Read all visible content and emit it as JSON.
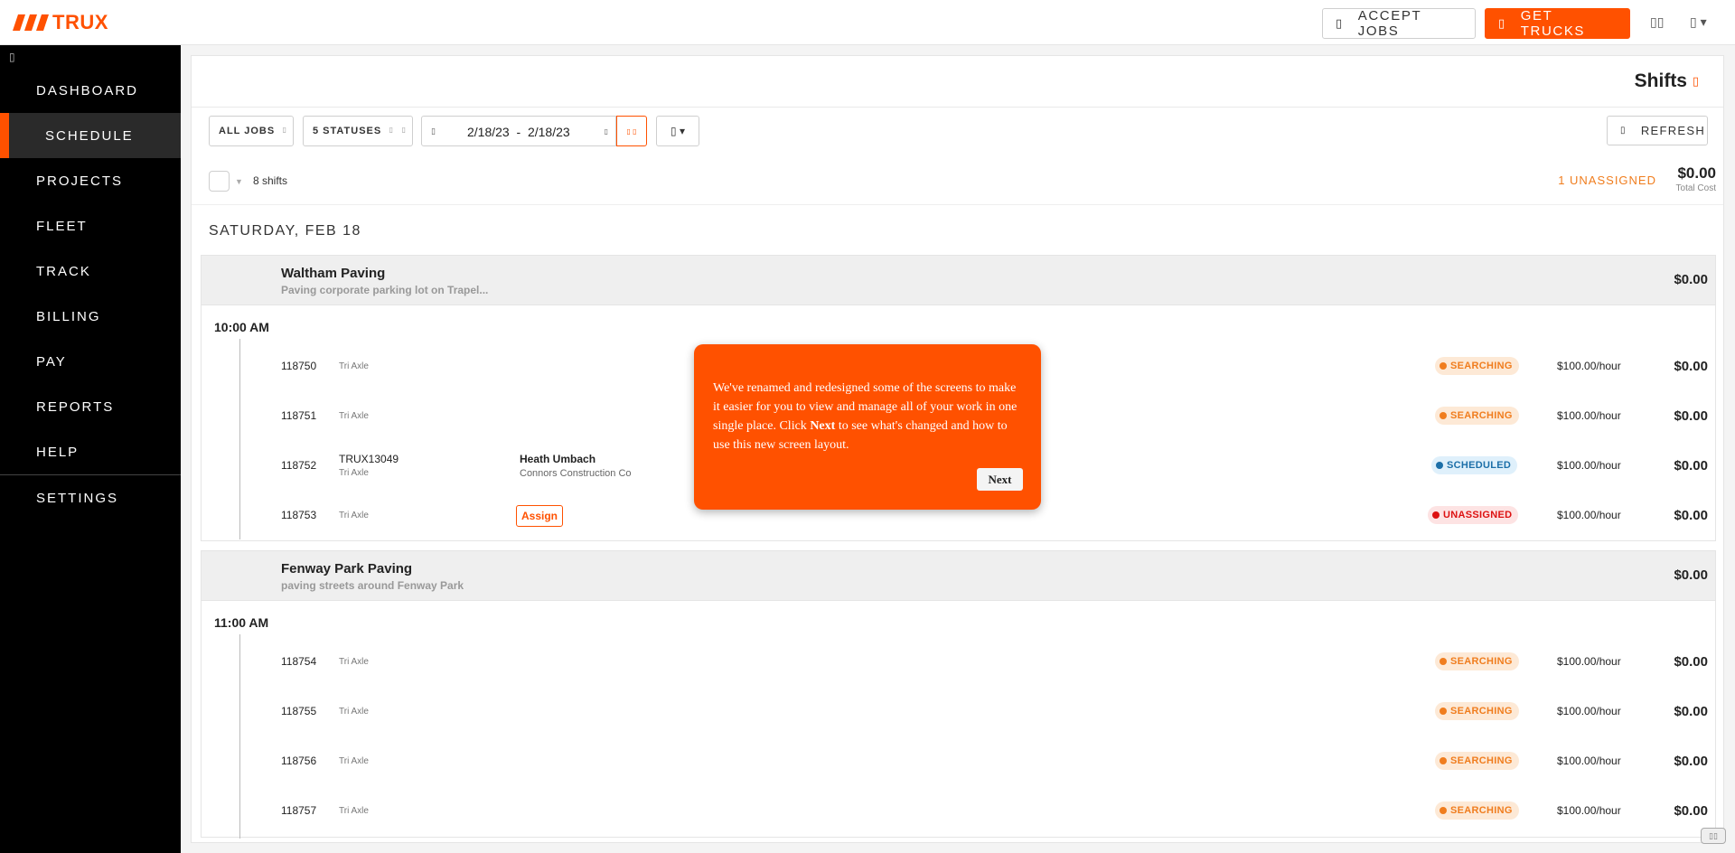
{
  "topbar": {
    "logo_text": "TRUX",
    "accept_label": "ACCEPT JOBS",
    "get_label": "GET TRUCKS",
    "brand_color": "#ff5100"
  },
  "sidebar": {
    "items": [
      {
        "label": "DASHBOARD"
      },
      {
        "label": "SCHEDULE",
        "active": true
      },
      {
        "label": "PROJECTS"
      },
      {
        "label": "FLEET"
      },
      {
        "label": "TRACK"
      },
      {
        "label": "BILLING"
      },
      {
        "label": "PAY"
      },
      {
        "label": "REPORTS"
      },
      {
        "label": "HELP"
      },
      {
        "label": "SETTINGS"
      }
    ]
  },
  "page": {
    "title": "Shifts"
  },
  "filters": {
    "jobs": "ALL JOBS",
    "statuses": "5 STATUSES",
    "date_start": "2/18/23",
    "date_sep": "-",
    "date_end": "2/18/23",
    "refresh": "REFRESH"
  },
  "summary": {
    "shift_count": "8 shifts",
    "unassigned": "1 UNASSIGNED",
    "total_cost": "$0.00",
    "total_label": "Total Cost"
  },
  "day": "SATURDAY, FEB 18",
  "groups": [
    {
      "name": "Waltham Paving",
      "description": "Paving corporate parking lot on Trapel...",
      "cost": "$0.00",
      "time": "10:00 AM",
      "shifts": [
        {
          "id": "118750",
          "truck_type": "Tri Axle",
          "status": "SEARCHING",
          "rate": "$100.00/hour",
          "cost": "$0.00"
        },
        {
          "id": "118751",
          "truck_type": "Tri Axle",
          "status": "SEARCHING",
          "rate": "$100.00/hour",
          "cost": "$0.00"
        },
        {
          "id": "118752",
          "truck": "TRUX13049",
          "truck_type": "Tri Axle",
          "driver": "Heath Umbach",
          "company": "Connors Construction Co",
          "status": "SCHEDULED",
          "rate": "$100.00/hour",
          "cost": "$0.00"
        },
        {
          "id": "118753",
          "truck_type": "Tri Axle",
          "assign_label": "Assign",
          "status": "UNASSIGNED",
          "rate": "$100.00/hour",
          "cost": "$0.00"
        }
      ]
    },
    {
      "name": "Fenway Park Paving",
      "description": "paving streets around Fenway Park",
      "cost": "$0.00",
      "time": "11:00 AM",
      "shifts": [
        {
          "id": "118754",
          "truck_type": "Tri Axle",
          "status": "SEARCHING",
          "rate": "$100.00/hour",
          "cost": "$0.00"
        },
        {
          "id": "118755",
          "truck_type": "Tri Axle",
          "status": "SEARCHING",
          "rate": "$100.00/hour",
          "cost": "$0.00"
        },
        {
          "id": "118756",
          "truck_type": "Tri Axle",
          "status": "SEARCHING",
          "rate": "$100.00/hour",
          "cost": "$0.00"
        },
        {
          "id": "118757",
          "truck_type": "Tri Axle",
          "status": "SEARCHING",
          "rate": "$100.00/hour",
          "cost": "$0.00"
        }
      ]
    }
  ],
  "tour": {
    "text_1": "We've renamed and redesigned some of the screens to make it easier for you to view and manage all of your work in one single place. Click ",
    "text_bold": "Next",
    "text_2": " to see what's changed and how to use this new screen layout.",
    "next_label": "Next"
  },
  "status_colors": {
    "searching": "#f07d1e",
    "scheduled": "#1c6fa8",
    "unassigned": "#dd1111"
  }
}
